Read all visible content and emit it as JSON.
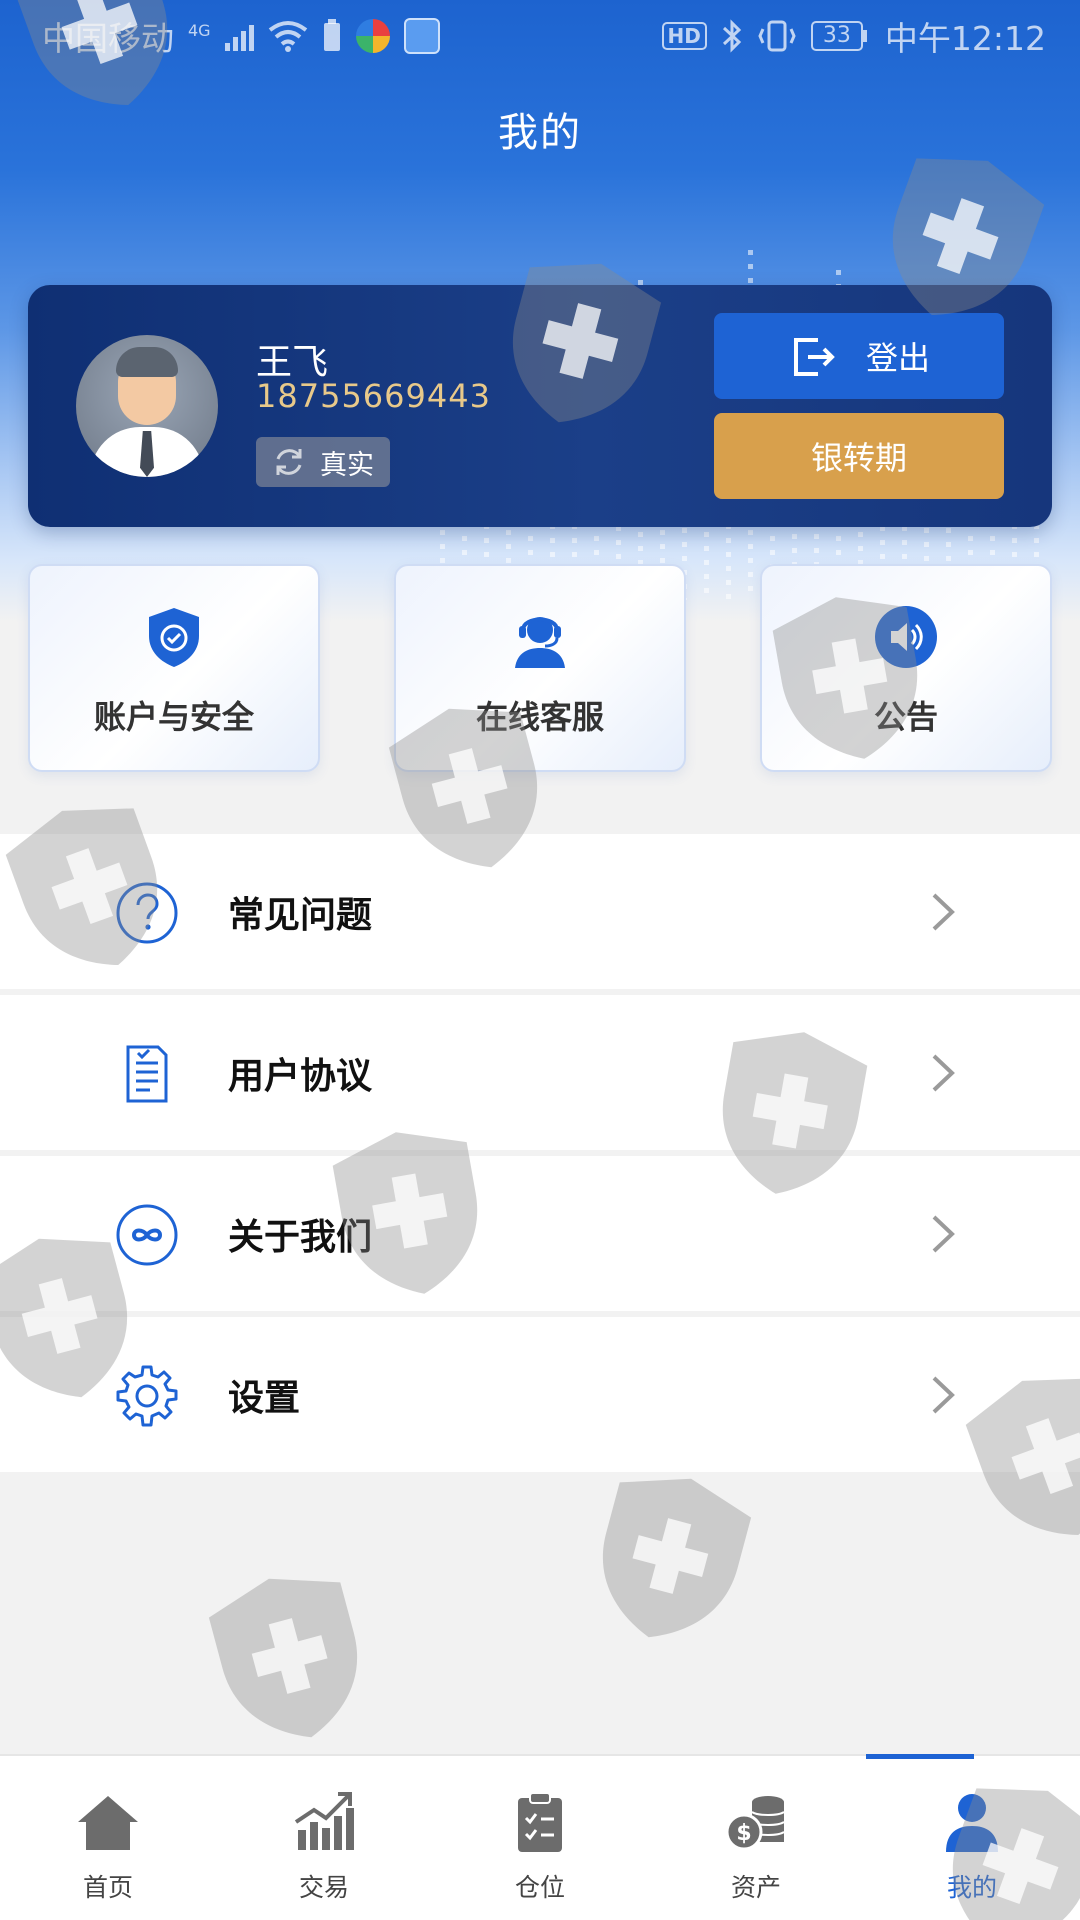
{
  "status_bar": {
    "carrier": "中国移动",
    "network": "4G",
    "battery": "33",
    "time": "中午12:12"
  },
  "header": {
    "title": "我的"
  },
  "profile": {
    "name": "王飞",
    "phone": "18755669443",
    "verify_label": "真实",
    "logout_label": "登出",
    "bank_transfer_label": "银转期"
  },
  "quick_tiles": [
    {
      "label": "账户与安全",
      "icon": "shield-check-icon"
    },
    {
      "label": "在线客服",
      "icon": "headset-icon"
    },
    {
      "label": "公告",
      "icon": "speaker-icon"
    }
  ],
  "menu": [
    {
      "label": "常见问题",
      "icon": "question-icon"
    },
    {
      "label": "用户协议",
      "icon": "document-icon"
    },
    {
      "label": "关于我们",
      "icon": "infinity-icon"
    },
    {
      "label": "设置",
      "icon": "gear-icon"
    }
  ],
  "tabbar": {
    "items": [
      {
        "label": "首页",
        "icon": "home-icon"
      },
      {
        "label": "交易",
        "icon": "chart-icon"
      },
      {
        "label": "仓位",
        "icon": "clipboard-icon"
      },
      {
        "label": "资产",
        "icon": "coins-icon"
      },
      {
        "label": "我的",
        "icon": "user-icon"
      }
    ],
    "active_index": 4
  },
  "colors": {
    "primary": "#1e63d4",
    "card_dark": "#16367c",
    "gold": "#d8a04c",
    "phone_gold": "#e8c98a"
  }
}
